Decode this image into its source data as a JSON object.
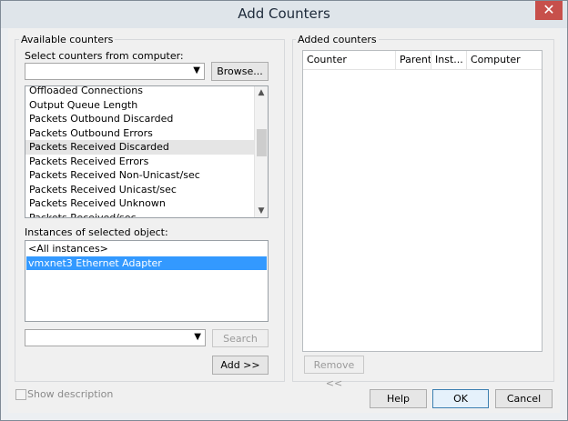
{
  "window": {
    "title": "Add Counters",
    "close_glyph": "✕"
  },
  "available": {
    "group_label": "Available counters",
    "select_label": "Select counters from computer:",
    "computer_value": "",
    "browse_label": "Browse...",
    "counters": [
      "Offloaded Connections",
      "Output Queue Length",
      "Packets Outbound Discarded",
      "Packets Outbound Errors",
      "Packets Received Discarded",
      "Packets Received Errors",
      "Packets Received Non-Unicast/sec",
      "Packets Received Unicast/sec",
      "Packets Received Unknown",
      "Packets Received/sec"
    ],
    "selected_counter_index": 4,
    "instances_label": "Instances of selected object:",
    "instances": [
      "<All instances>",
      "vmxnet3 Ethernet Adapter"
    ],
    "selected_instance_index": 1,
    "search_value": "",
    "search_label": "Search",
    "add_label": "Add >>"
  },
  "added": {
    "group_label": "Added counters",
    "columns": [
      "Counter",
      "Parent",
      "Inst...",
      "Computer"
    ],
    "remove_label": "Remove <<"
  },
  "footer": {
    "show_description_label": "Show description",
    "help_label": "Help",
    "ok_label": "OK",
    "cancel_label": "Cancel"
  },
  "icons": {
    "scroll_up": "▲",
    "scroll_down": "▼",
    "dropdown": "▼"
  }
}
